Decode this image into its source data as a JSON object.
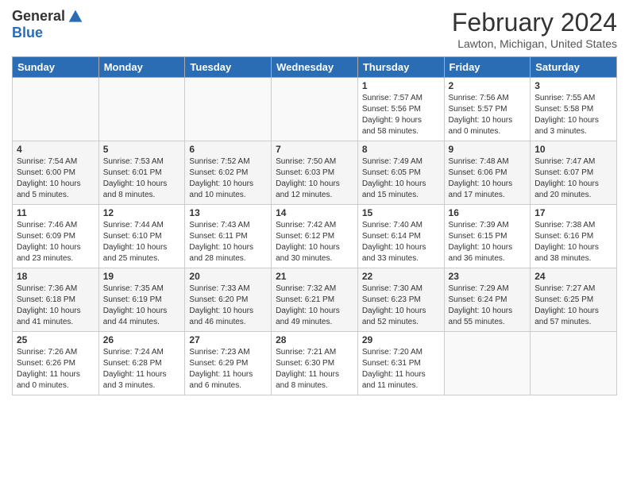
{
  "header": {
    "logo": {
      "general": "General",
      "blue": "Blue"
    },
    "title": "February 2024",
    "location": "Lawton, Michigan, United States"
  },
  "weekdays": [
    "Sunday",
    "Monday",
    "Tuesday",
    "Wednesday",
    "Thursday",
    "Friday",
    "Saturday"
  ],
  "weeks": [
    [
      {
        "day": "",
        "info": ""
      },
      {
        "day": "",
        "info": ""
      },
      {
        "day": "",
        "info": ""
      },
      {
        "day": "",
        "info": ""
      },
      {
        "day": "1",
        "info": "Sunrise: 7:57 AM\nSunset: 5:56 PM\nDaylight: 9 hours\nand 58 minutes."
      },
      {
        "day": "2",
        "info": "Sunrise: 7:56 AM\nSunset: 5:57 PM\nDaylight: 10 hours\nand 0 minutes."
      },
      {
        "day": "3",
        "info": "Sunrise: 7:55 AM\nSunset: 5:58 PM\nDaylight: 10 hours\nand 3 minutes."
      }
    ],
    [
      {
        "day": "4",
        "info": "Sunrise: 7:54 AM\nSunset: 6:00 PM\nDaylight: 10 hours\nand 5 minutes."
      },
      {
        "day": "5",
        "info": "Sunrise: 7:53 AM\nSunset: 6:01 PM\nDaylight: 10 hours\nand 8 minutes."
      },
      {
        "day": "6",
        "info": "Sunrise: 7:52 AM\nSunset: 6:02 PM\nDaylight: 10 hours\nand 10 minutes."
      },
      {
        "day": "7",
        "info": "Sunrise: 7:50 AM\nSunset: 6:03 PM\nDaylight: 10 hours\nand 12 minutes."
      },
      {
        "day": "8",
        "info": "Sunrise: 7:49 AM\nSunset: 6:05 PM\nDaylight: 10 hours\nand 15 minutes."
      },
      {
        "day": "9",
        "info": "Sunrise: 7:48 AM\nSunset: 6:06 PM\nDaylight: 10 hours\nand 17 minutes."
      },
      {
        "day": "10",
        "info": "Sunrise: 7:47 AM\nSunset: 6:07 PM\nDaylight: 10 hours\nand 20 minutes."
      }
    ],
    [
      {
        "day": "11",
        "info": "Sunrise: 7:46 AM\nSunset: 6:09 PM\nDaylight: 10 hours\nand 23 minutes."
      },
      {
        "day": "12",
        "info": "Sunrise: 7:44 AM\nSunset: 6:10 PM\nDaylight: 10 hours\nand 25 minutes."
      },
      {
        "day": "13",
        "info": "Sunrise: 7:43 AM\nSunset: 6:11 PM\nDaylight: 10 hours\nand 28 minutes."
      },
      {
        "day": "14",
        "info": "Sunrise: 7:42 AM\nSunset: 6:12 PM\nDaylight: 10 hours\nand 30 minutes."
      },
      {
        "day": "15",
        "info": "Sunrise: 7:40 AM\nSunset: 6:14 PM\nDaylight: 10 hours\nand 33 minutes."
      },
      {
        "day": "16",
        "info": "Sunrise: 7:39 AM\nSunset: 6:15 PM\nDaylight: 10 hours\nand 36 minutes."
      },
      {
        "day": "17",
        "info": "Sunrise: 7:38 AM\nSunset: 6:16 PM\nDaylight: 10 hours\nand 38 minutes."
      }
    ],
    [
      {
        "day": "18",
        "info": "Sunrise: 7:36 AM\nSunset: 6:18 PM\nDaylight: 10 hours\nand 41 minutes."
      },
      {
        "day": "19",
        "info": "Sunrise: 7:35 AM\nSunset: 6:19 PM\nDaylight: 10 hours\nand 44 minutes."
      },
      {
        "day": "20",
        "info": "Sunrise: 7:33 AM\nSunset: 6:20 PM\nDaylight: 10 hours\nand 46 minutes."
      },
      {
        "day": "21",
        "info": "Sunrise: 7:32 AM\nSunset: 6:21 PM\nDaylight: 10 hours\nand 49 minutes."
      },
      {
        "day": "22",
        "info": "Sunrise: 7:30 AM\nSunset: 6:23 PM\nDaylight: 10 hours\nand 52 minutes."
      },
      {
        "day": "23",
        "info": "Sunrise: 7:29 AM\nSunset: 6:24 PM\nDaylight: 10 hours\nand 55 minutes."
      },
      {
        "day": "24",
        "info": "Sunrise: 7:27 AM\nSunset: 6:25 PM\nDaylight: 10 hours\nand 57 minutes."
      }
    ],
    [
      {
        "day": "25",
        "info": "Sunrise: 7:26 AM\nSunset: 6:26 PM\nDaylight: 11 hours\nand 0 minutes."
      },
      {
        "day": "26",
        "info": "Sunrise: 7:24 AM\nSunset: 6:28 PM\nDaylight: 11 hours\nand 3 minutes."
      },
      {
        "day": "27",
        "info": "Sunrise: 7:23 AM\nSunset: 6:29 PM\nDaylight: 11 hours\nand 6 minutes."
      },
      {
        "day": "28",
        "info": "Sunrise: 7:21 AM\nSunset: 6:30 PM\nDaylight: 11 hours\nand 8 minutes."
      },
      {
        "day": "29",
        "info": "Sunrise: 7:20 AM\nSunset: 6:31 PM\nDaylight: 11 hours\nand 11 minutes."
      },
      {
        "day": "",
        "info": ""
      },
      {
        "day": "",
        "info": ""
      }
    ]
  ]
}
